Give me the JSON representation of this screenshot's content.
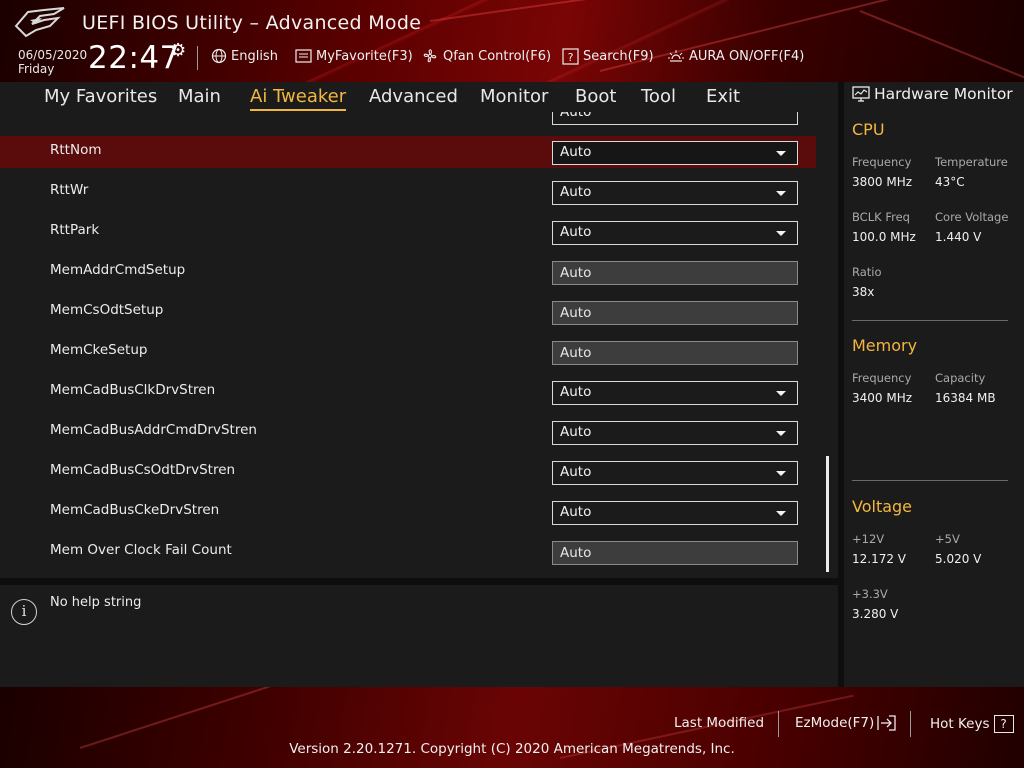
{
  "header": {
    "title": "UEFI BIOS Utility – Advanced Mode",
    "date": "06/05/2020",
    "day": "Friday",
    "time": "22:47",
    "items": {
      "language": "English",
      "favorite": "MyFavorite(F3)",
      "qfan": "Qfan Control(F6)",
      "search": "Search(F9)",
      "aura": "AURA ON/OFF(F4)"
    }
  },
  "nav": {
    "tabs": [
      "My Favorites",
      "Main",
      "Ai Tweaker",
      "Advanced",
      "Monitor",
      "Boot",
      "Tool",
      "Exit"
    ],
    "active": "Ai Tweaker"
  },
  "settings": {
    "partial_top_value": "Auto",
    "rows": [
      {
        "label": "RttNom",
        "value": "Auto",
        "type": "dropdown",
        "selected": true
      },
      {
        "label": "RttWr",
        "value": "Auto",
        "type": "dropdown"
      },
      {
        "label": "RttPark",
        "value": "Auto",
        "type": "dropdown"
      },
      {
        "label": "MemAddrCmdSetup",
        "value": "Auto",
        "type": "text"
      },
      {
        "label": "MemCsOdtSetup",
        "value": "Auto",
        "type": "text"
      },
      {
        "label": "MemCkeSetup",
        "value": "Auto",
        "type": "text"
      },
      {
        "label": "MemCadBusClkDrvStren",
        "value": "Auto",
        "type": "dropdown"
      },
      {
        "label": "MemCadBusAddrCmdDrvStren",
        "value": "Auto",
        "type": "dropdown"
      },
      {
        "label": "MemCadBusCsOdtDrvStren",
        "value": "Auto",
        "type": "dropdown"
      },
      {
        "label": "MemCadBusCkeDrvStren",
        "value": "Auto",
        "type": "dropdown"
      },
      {
        "label": "Mem Over Clock Fail Count",
        "value": "Auto",
        "type": "text"
      }
    ]
  },
  "help": {
    "text": "No help string"
  },
  "hardware_monitor": {
    "title": "Hardware Monitor",
    "cpu": {
      "heading": "CPU",
      "frequency_label": "Frequency",
      "frequency": "3800 MHz",
      "temperature_label": "Temperature",
      "temperature": "43°C",
      "bclk_label": "BCLK Freq",
      "bclk": "100.0 MHz",
      "core_voltage_label": "Core Voltage",
      "core_voltage": "1.440 V",
      "ratio_label": "Ratio",
      "ratio": "38x"
    },
    "memory": {
      "heading": "Memory",
      "frequency_label": "Frequency",
      "frequency": "3400 MHz",
      "capacity_label": "Capacity",
      "capacity": "16384 MB"
    },
    "voltage": {
      "heading": "Voltage",
      "v12_label": "+12V",
      "v12": "12.172 V",
      "v5_label": "+5V",
      "v5": "5.020 V",
      "v33_label": "+3.3V",
      "v33": "3.280 V"
    }
  },
  "footer": {
    "last_modified": "Last Modified",
    "ezmode": "EzMode(F7)",
    "hotkeys": "Hot Keys",
    "hotkeys_key": "?",
    "version": "Version 2.20.1271. Copyright (C) 2020 American Megatrends, Inc."
  },
  "colors": {
    "accent": "#f3b63f",
    "selected_row": "#5a0b0b",
    "panel_bg": "#1b1b1b",
    "header_red": "#7a0505"
  }
}
